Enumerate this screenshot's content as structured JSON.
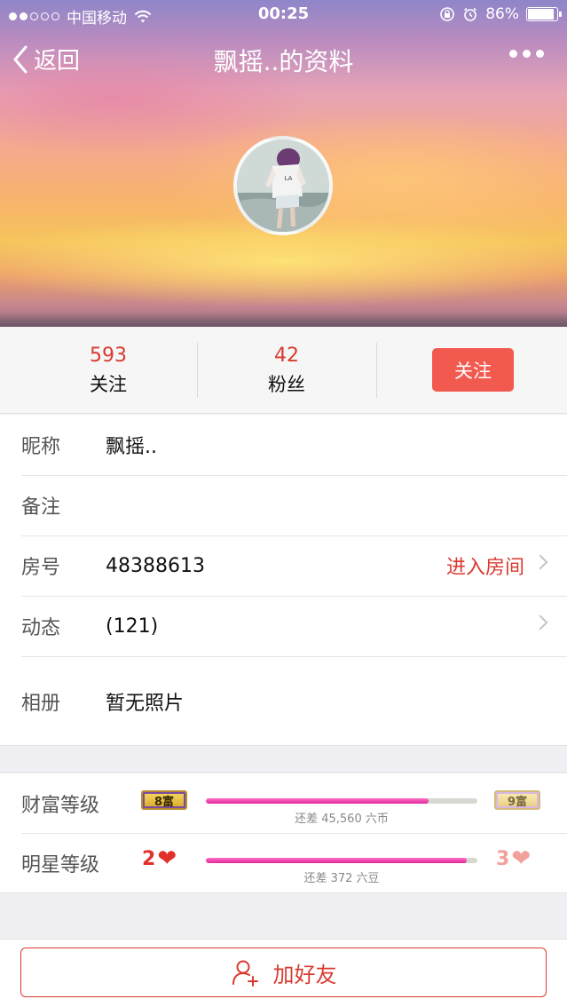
{
  "status_bar": {
    "carrier": "中国移动",
    "time": "00:25",
    "battery": "86%",
    "battery_level": 0.86,
    "signal_bars_on": 2,
    "signal_bars_total": 5
  },
  "nav": {
    "back_label": "返回",
    "title": "飘摇..的资料"
  },
  "stats": {
    "following_count": "593",
    "following_label": "关注",
    "followers_count": "42",
    "followers_label": "粉丝",
    "follow_button": "关注"
  },
  "info": {
    "nickname_label": "昵称",
    "nickname_value": "飘摇..",
    "remark_label": "备注",
    "room_label": "房号",
    "room_value": "48388613",
    "room_link": "进入房间",
    "activity_label": "动态",
    "activity_value": "(121)",
    "album_label": "相册",
    "album_value": "暂无照片"
  },
  "levels": {
    "wealth_label": "财富等级",
    "wealth_current": "8富",
    "wealth_next": "9富",
    "wealth_progress": 0.82,
    "wealth_note": "还差 45,560 六币",
    "star_label": "明星等级",
    "star_current": "2",
    "star_next": "3",
    "star_progress": 0.96,
    "star_note": "还差 372 六豆"
  },
  "bottom": {
    "add_friend": "加好友"
  },
  "colors": {
    "accent": "#d93a2f",
    "follow_button_bg": "#f25a4f",
    "progress_fill": "#e0279a"
  }
}
